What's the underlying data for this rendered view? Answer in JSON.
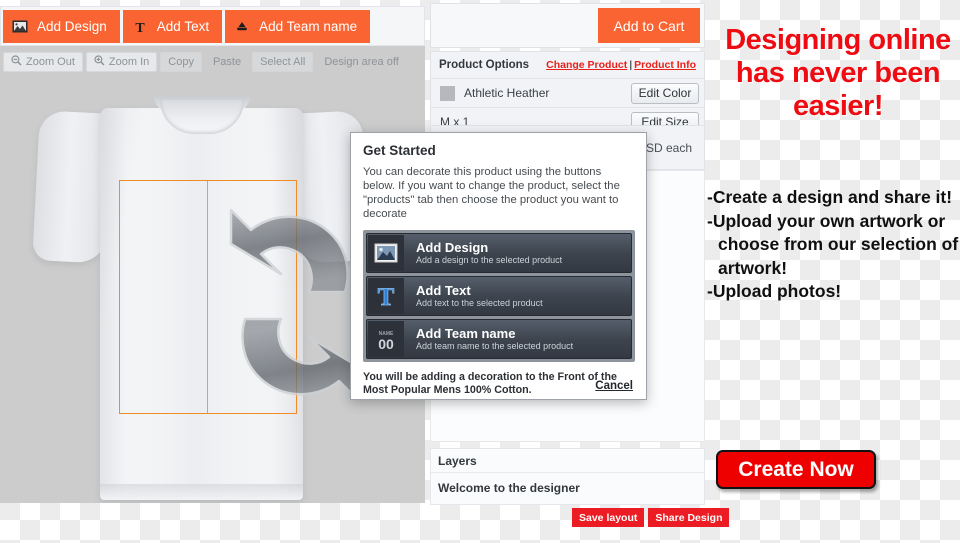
{
  "toolbar": {
    "actions": [
      {
        "label": "Add Design",
        "icon": "image-icon"
      },
      {
        "label": "Add Text",
        "icon": "text-t-icon"
      },
      {
        "label": "Add Team name",
        "icon": "team-name-icon"
      }
    ],
    "edit_tools": [
      {
        "label": "Zoom Out",
        "icon": "zoom-out-icon"
      },
      {
        "label": "Zoom In",
        "icon": "zoom-in-icon"
      },
      {
        "label": "Copy",
        "icon": "copy-icon"
      },
      {
        "label": "Paste",
        "icon": "paste-icon"
      },
      {
        "label": "Select All",
        "icon": "select-all-icon"
      },
      {
        "label": "Design area off",
        "icon": "design-area-icon"
      }
    ]
  },
  "cart": {
    "add_to_cart_label": "Add to Cart"
  },
  "product_options": {
    "title": "Product Options",
    "change_product_label": "Change Product",
    "separator": "|",
    "product_info_label": "Product Info",
    "color_value": "Athletic Heather",
    "color_swatch": "#b6b8bd",
    "edit_color_label": "Edit Color",
    "size_value": "M x 1",
    "edit_size_label": "Edit Size",
    "price_unit": "USD each"
  },
  "layers": {
    "title": "Layers",
    "item": "Welcome to the designer"
  },
  "bottom_buttons": {
    "save_layout_label": "Save layout",
    "share_design_label": "Share Design"
  },
  "modal": {
    "title": "Get Started",
    "intro": "You can decorate this product using the buttons below. If you want to change the product, select the \"products\" tab then choose the product you want to decorate",
    "choices": [
      {
        "title": "Add Design",
        "sub": "Add a design to the selected product",
        "icon": "image-icon"
      },
      {
        "title": "Add Text",
        "sub": "Add text to the selected product",
        "icon": "text-t-icon"
      },
      {
        "title": "Add Team name",
        "sub": "Add team name to the selected product",
        "icon": "team-number-icon"
      }
    ],
    "note": "You will be adding a decoration to the Front of the Most Popular Mens 100% Cotton.",
    "cancel_label": "Cancel"
  },
  "promo": {
    "headline_line1": "Designing online",
    "headline_line2": "has never been",
    "headline_line3": "easier!",
    "headline_color": "#ee0b11",
    "bullets": [
      "-Create a design and share it!",
      "-Upload your own artwork or",
      "choose from our selection of",
      "artwork!",
      "-Upload photos!"
    ],
    "cta_label": "Create Now",
    "cta_color": "#ee0000"
  }
}
